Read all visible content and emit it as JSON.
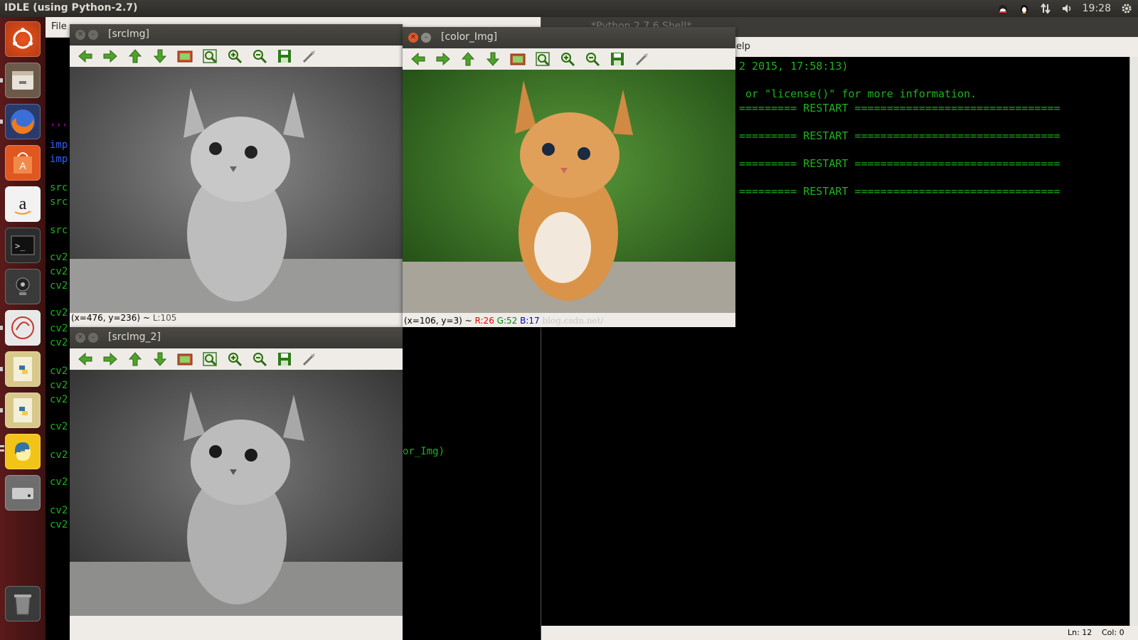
{
  "top_panel": {
    "title": "IDLE (using Python-2.7)",
    "time": "19:28"
  },
  "editor": {
    "menu_file": "File",
    "code_lines": [
      {
        "text": "'''",
        "color": "#c000c0"
      },
      {
        "text": "imp",
        "color": "#3060ff"
      },
      {
        "text": "imp",
        "color": "#3060ff"
      },
      {
        "text": "src",
        "color": "#1db31d"
      },
      {
        "text": "src",
        "color": "#1db31d"
      },
      {
        "text": "src",
        "color": "#1db31d"
      },
      {
        "text": "cv2",
        "color": "#1db31d"
      },
      {
        "text": "cv2",
        "color": "#1db31d"
      },
      {
        "text": "cv2",
        "color": "#1db31d"
      },
      {
        "text": "cv2",
        "color": "#1db31d"
      },
      {
        "text": "cv2",
        "color": "#1db31d"
      },
      {
        "text": "cv2",
        "color": "#1db31d"
      },
      {
        "text": "cv2",
        "color": "#1db31d"
      },
      {
        "text": "cv2",
        "color": "#1db31d"
      },
      {
        "text": "cv2",
        "color": "#1db31d"
      },
      {
        "text": "cv2",
        "color": "#1db31d"
      },
      {
        "text": "cv2",
        "color": "#1db31d"
      },
      {
        "text": "cv2",
        "color": "#1db31d"
      },
      {
        "text": "cv2",
        "color": "#1db31d"
      },
      {
        "text": "cv2",
        "color": "#1db31d"
      }
    ],
    "fragment_color_img": "or_Img)"
  },
  "shell": {
    "title": "*Python 2.7.6 Shell*",
    "menu_help": "elp",
    "lines": [
      "2 2015, 17:58:13)",
      " or \"license()\" for more information.",
      "========= RESTART ================================",
      "========= RESTART ================================",
      "========= RESTART ================================",
      "========= RESTART ================================"
    ],
    "status_ln": "Ln: 12",
    "status_col": "Col: 0"
  },
  "windows": {
    "src": {
      "title": "[srcImg]",
      "coords": "(x=476, y=236) ~",
      "lum": "L:105"
    },
    "color": {
      "title": "[color_Img]",
      "coords": "(x=106, y=3) ~",
      "r": "R:26",
      "g": "G:52",
      "b": "B:17",
      "watermark": "blog.csdn.net/"
    },
    "src2": {
      "title": "[srcImg_2]"
    }
  },
  "toolbar_icons": [
    "arrow-left-icon",
    "arrow-right-icon",
    "arrow-up-icon",
    "arrow-down-icon",
    "image-icon",
    "zoom-fit-icon",
    "zoom-in-icon",
    "zoom-out-icon",
    "save-icon",
    "properties-icon"
  ],
  "launcher_icons": [
    "ubuntu-dash-icon",
    "files-icon",
    "firefox-icon",
    "software-center-icon",
    "amazon-icon",
    "terminal-icon",
    "webcam-icon",
    "text-editor-icon",
    "python-script-icon",
    "python-script-icon",
    "python-icon",
    "drive-icon",
    "trash-icon"
  ]
}
